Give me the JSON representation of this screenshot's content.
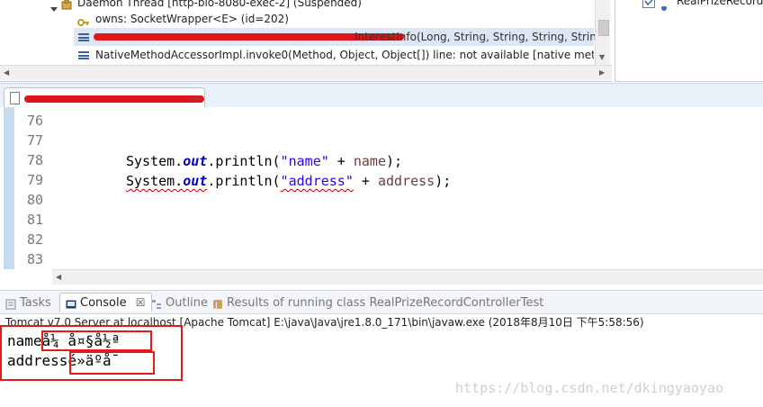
{
  "debug": {
    "thread_label": "Daemon Thread [http-bio-8080-exec-2] (Suspended)",
    "owns_label": "owns: SocketWrapper<E>  (id=202)",
    "selected_frame_suffix": "InterestInfo(Long, String, String, String, String,",
    "native_frame": "NativeMethodAccessorImpl.invoke0(Method, Object, Object[]) line: not available [native method"
  },
  "right_panel": {
    "item_label": "RealPrizeRecordC"
  },
  "editor": {
    "tab_suffix": "...",
    "lines": [
      {
        "num": "76"
      },
      {
        "num": "77"
      },
      {
        "num": "78",
        "prefix": "System.",
        "kw": "out",
        "call": ".println(",
        "str": "\"name\"",
        "plus": " + ",
        "var": "name",
        "end": ");"
      },
      {
        "num": "79",
        "prefix": "System.",
        "kw": "out",
        "call": ".println(",
        "str": "\"address\"",
        "plus": " + ",
        "var": "address",
        "end": ");"
      },
      {
        "num": "80"
      },
      {
        "num": "81"
      },
      {
        "num": "82"
      },
      {
        "num": "83"
      }
    ]
  },
  "console_tabs": {
    "tasks": "Tasks",
    "console": "Console",
    "console_close": "☒",
    "outline": "Outline",
    "results": "Results of running class RealPrizeRecordControllerTest"
  },
  "console": {
    "header": "Tomcat v7.0 Server at localhost [Apache Tomcat] E:\\java\\Java\\jre1.8.0_171\\bin\\javaw.exe (2018年8月10日 下午5:58:56)",
    "line1_label": "name",
    "line1_value": "å¼ å¤§å½ª",
    "line2_label": "address",
    "line2_value": "é»äºå¯"
  },
  "watermark": "https://blog.csdn.net/dkingyaoyao",
  "colors": {
    "redaction": "#e0161b",
    "annotation_box": "#e11b1b",
    "keyword": "#0000c0",
    "string": "#2a00ff"
  }
}
